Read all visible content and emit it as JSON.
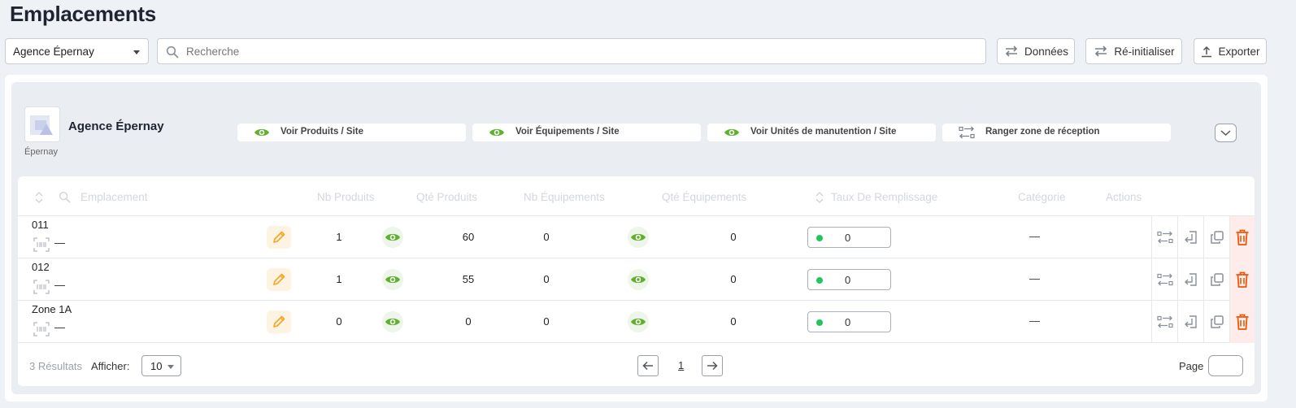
{
  "page": {
    "title": "Emplacements"
  },
  "toolbar": {
    "agency_select": "Agence Épernay",
    "search_placeholder": "Recherche",
    "data_label": "Données",
    "reset_label": "Ré-initialiser",
    "export_label": "Exporter"
  },
  "agency": {
    "name": "Agence Épernay",
    "city": "Épernay"
  },
  "actions": {
    "view_products": "Voir Produits / Site",
    "view_equipment": "Voir Équipements / Site",
    "view_handling_units": "Voir Unités de manutention / Site",
    "store_reception": "Ranger zone de réception"
  },
  "table": {
    "headers": {
      "location": "Emplacement",
      "nb_products": "Nb Produits",
      "qty_products": "Qté Produits",
      "nb_equipment": "Nb Équipements",
      "qty_equipment": "Qté Équipements",
      "fill_rate": "Taux De Remplissage",
      "category": "Catégorie",
      "actions": "Actions"
    },
    "rows": [
      {
        "name": "011",
        "barcode": "—",
        "nb_products": "1",
        "qty_products": "60",
        "nb_equipment": "0",
        "qty_equipment": "0",
        "fill_rate": "0",
        "category": "—"
      },
      {
        "name": "012",
        "barcode": "—",
        "nb_products": "1",
        "qty_products": "55",
        "nb_equipment": "0",
        "qty_equipment": "0",
        "fill_rate": "0",
        "category": "—"
      },
      {
        "name": "Zone 1A",
        "barcode": "—",
        "nb_products": "0",
        "qty_products": "0",
        "nb_equipment": "0",
        "qty_equipment": "0",
        "fill_rate": "0",
        "category": "—"
      }
    ]
  },
  "footer": {
    "results": "3 Résultats",
    "show_label": "Afficher:",
    "page_size": "10",
    "current_page": "1",
    "page_label": "Page"
  },
  "colors": {
    "accent_green": "#5fb02c",
    "edit_orange": "#f5a623",
    "delete_red": "#e8590c",
    "fill_dot": "#22c55e"
  }
}
